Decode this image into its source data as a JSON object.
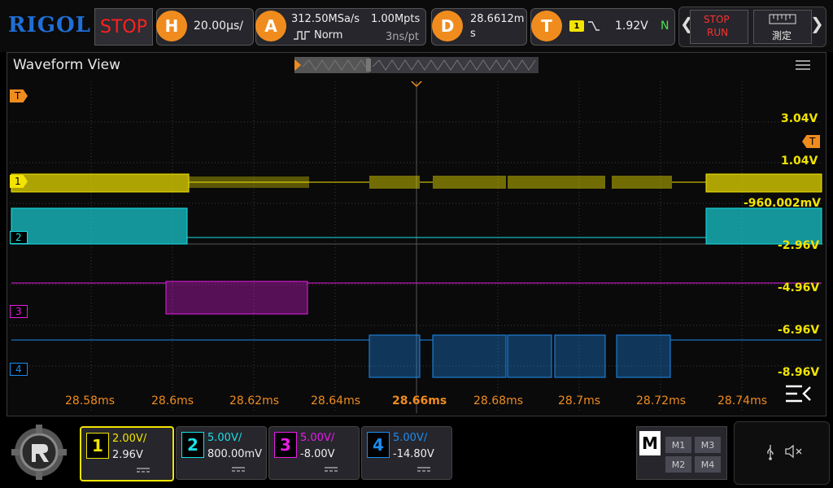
{
  "brand": "RIGOL",
  "run_state": "STOP",
  "horizontal": {
    "icon": "H",
    "timebase": "20.00µs/"
  },
  "acquire": {
    "icon": "A",
    "sample_rate": "312.50MSa/s",
    "memory_depth": "1.00Mpts",
    "mode": "Norm",
    "period": "3ns/pt"
  },
  "delay": {
    "icon": "D",
    "value": "28.6612m",
    "unit": "s"
  },
  "trigger": {
    "icon": "T",
    "source": "1",
    "level": "1.92V",
    "sweep": "N"
  },
  "controls": {
    "stop_label": "STOP",
    "run_label": "RUN",
    "measure_label": "測定"
  },
  "waveform": {
    "title": "Waveform View",
    "trigger_marker": "T",
    "level_labels": [
      "3.04V",
      "1.04V",
      "-960.002mV",
      "-2.96V",
      "-4.96V",
      "-6.96V",
      "-8.96V"
    ],
    "time_labels": [
      "28.58ms",
      "28.6ms",
      "28.62ms",
      "28.64ms",
      "28.66ms",
      "28.68ms",
      "28.7ms",
      "28.72ms",
      "28.74ms"
    ],
    "channel_markers": [
      "1",
      "2",
      "3",
      "4"
    ]
  },
  "channels": [
    {
      "num": "1",
      "scale": "2.00V/",
      "offset": "2.96V",
      "color": "#f2e400"
    },
    {
      "num": "2",
      "scale": "5.00V/",
      "offset": "800.00mV",
      "color": "#19e0e6"
    },
    {
      "num": "3",
      "scale": "5.00V/",
      "offset": "-8.00V",
      "color": "#e61ee6"
    },
    {
      "num": "4",
      "scale": "5.00V/",
      "offset": "-14.80V",
      "color": "#1e8cf0"
    }
  ],
  "math": {
    "label": "M",
    "slots": [
      "M1",
      "M3",
      "M2",
      "M4"
    ]
  },
  "colors": {
    "accent": "#f08c1e",
    "grid": "#3c3c3c",
    "stop": "#ff2020"
  },
  "icons": [
    "usb-icon",
    "mute-icon",
    "gear-logo-icon",
    "menu-icon"
  ]
}
